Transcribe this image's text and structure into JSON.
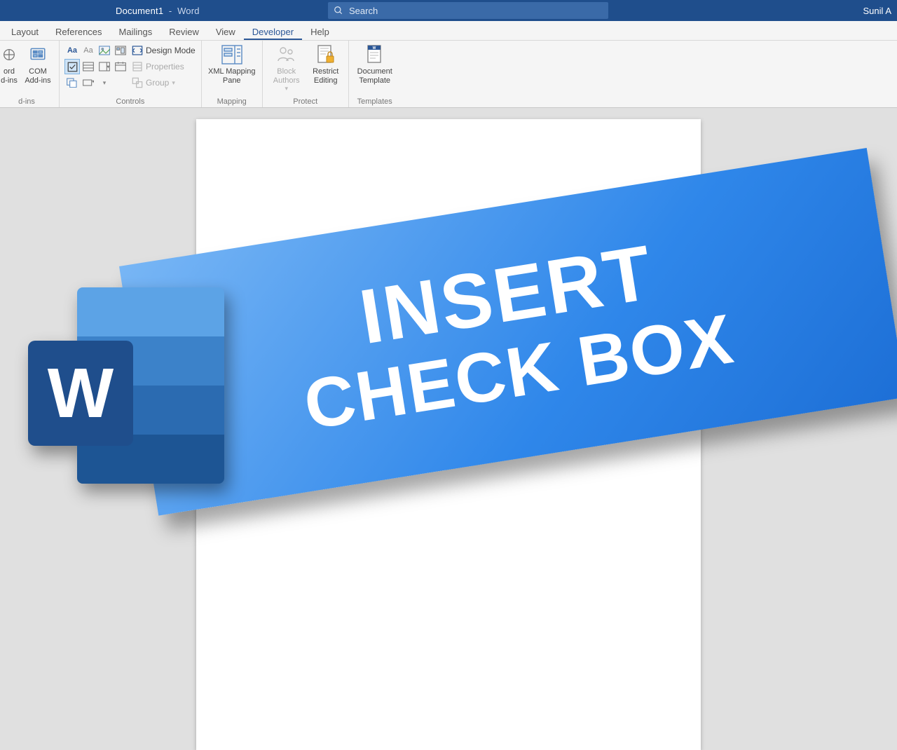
{
  "titlebar": {
    "doc": "Document1",
    "app": "Word",
    "search_placeholder": "Search",
    "user": "Sunil A"
  },
  "tabs": {
    "items": [
      {
        "label": "Layout"
      },
      {
        "label": "References"
      },
      {
        "label": "Mailings"
      },
      {
        "label": "Review"
      },
      {
        "label": "View"
      },
      {
        "label": "Developer",
        "active": true
      },
      {
        "label": "Help"
      }
    ]
  },
  "ribbon": {
    "addins": {
      "word_addins": "ord\nd-ins",
      "com_addins": "COM\nAdd-ins",
      "group": "d-ins"
    },
    "controls": {
      "design_mode": "Design Mode",
      "properties": "Properties",
      "group": "Group",
      "label": "Controls",
      "aa": "Aa"
    },
    "mapping": {
      "xml": "XML Mapping\nPane",
      "label": "Mapping"
    },
    "protect": {
      "block": "Block\nAuthors",
      "restrict": "Restrict\nEditing",
      "label": "Protect"
    },
    "templates": {
      "doc": "Document\nTemplate",
      "label": "Templates"
    }
  },
  "banner": {
    "line1": "INSERT",
    "line2": "CHECK BOX"
  },
  "logo": {
    "letter": "W"
  }
}
